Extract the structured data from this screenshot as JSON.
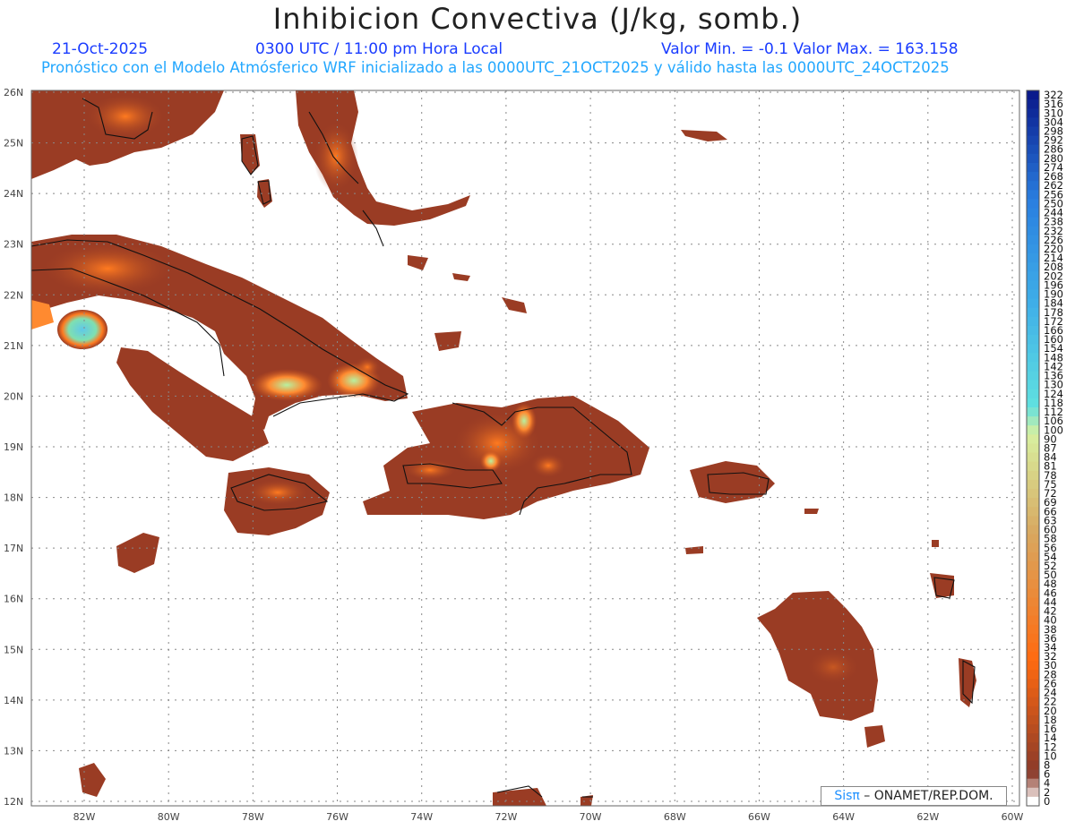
{
  "title": "Inhibicion Convectiva (J/kg, somb.)",
  "header": {
    "date": "21-Oct-2025",
    "time": "0300 UTC / 11:00 pm Hora Local",
    "minmax": "Valor Min. = -0.1  Valor Max. = 163.158",
    "model_line": "Pronóstico con el Modelo Atmósferico WRF inicializado a las 0000UTC_21OCT2025 y válido hasta las  0000UTC_24OCT2025"
  },
  "axes": {
    "lat_labels": [
      "26N",
      "25N",
      "24N",
      "23N",
      "22N",
      "21N",
      "20N",
      "19N",
      "18N",
      "17N",
      "16N",
      "15N",
      "14N",
      "13N",
      "12N"
    ],
    "lon_labels": [
      "82W",
      "80W",
      "78W",
      "76W",
      "74W",
      "72W",
      "70W",
      "68W",
      "66W",
      "64W",
      "62W",
      "60W"
    ]
  },
  "colorbar": {
    "labels": [
      "322",
      "316",
      "310",
      "304",
      "298",
      "292",
      "286",
      "280",
      "274",
      "268",
      "262",
      "256",
      "250",
      "244",
      "238",
      "232",
      "226",
      "220",
      "214",
      "208",
      "202",
      "196",
      "190",
      "184",
      "178",
      "172",
      "166",
      "160",
      "154",
      "148",
      "142",
      "136",
      "130",
      "124",
      "118",
      "112",
      "106",
      "100",
      "90",
      "87",
      "84",
      "81",
      "78",
      "75",
      "72",
      "69",
      "66",
      "63",
      "60",
      "58",
      "56",
      "54",
      "52",
      "50",
      "48",
      "46",
      "44",
      "42",
      "40",
      "38",
      "36",
      "34",
      "32",
      "30",
      "28",
      "26",
      "24",
      "22",
      "20",
      "18",
      "16",
      "14",
      "12",
      "10",
      "8",
      "6",
      "4",
      "2",
      "0"
    ],
    "colors": {
      "high": "#0a1a8c",
      "mid_blue": "#2a7fe0",
      "cyan": "#60e0e0",
      "pale_green": "#d8f0a0",
      "tan": "#d8a860",
      "orange": "#ff6a10",
      "brown": "#8a3a2a"
    }
  },
  "land_colors": {
    "base": "#9a3c24",
    "warm": "#c8501c",
    "hot": "#ff7a20",
    "peak": "#7fe0b0",
    "core": "#60c8e8"
  },
  "credit": {
    "sis": "Sisπ",
    "org": " – ONAMET/REP.DOM."
  }
}
